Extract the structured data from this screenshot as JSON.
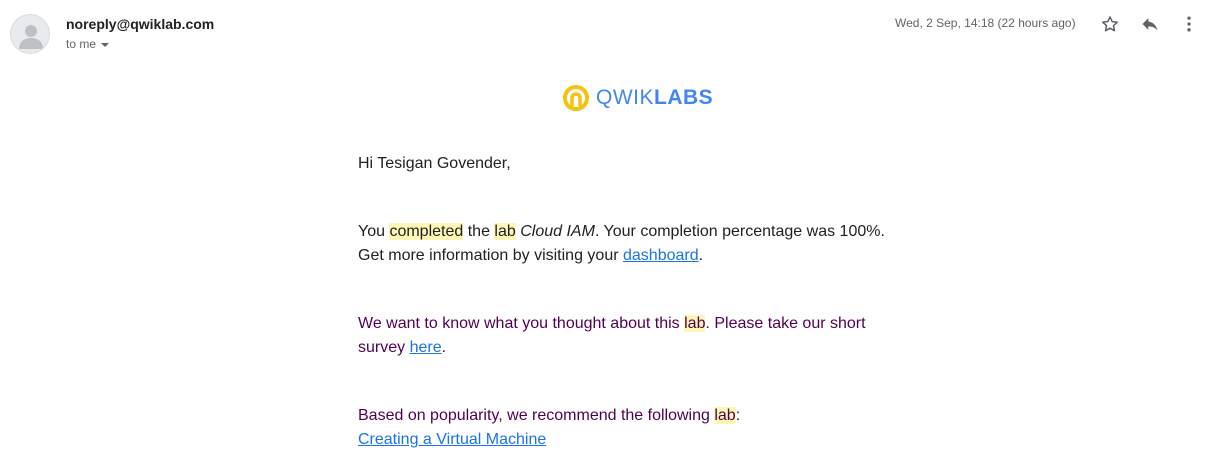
{
  "header": {
    "sender": "noreply@qwiklab.com",
    "recipient": "to me",
    "date": "Wed, 2 Sep, 14:18 (22 hours ago)"
  },
  "icons": [
    "avatar-person-icon",
    "star-icon",
    "reply-icon",
    "more-vert-icon",
    "qwiklabs-logo-icon"
  ],
  "logo": {
    "part1": "QWIK",
    "part2": "LABS"
  },
  "message": {
    "greeting": "Hi Tesigan Govender,",
    "p2": {
      "t1": "You ",
      "hl1": "completed",
      "t2": " the ",
      "hl2": "lab",
      "t3": " ",
      "lab_name": "Cloud IAM",
      "t4": ". Your completion percentage was 100%.",
      "t5": "Get more information by visiting your ",
      "link": "dashboard",
      "t6": "."
    },
    "p3": {
      "t1": "We want to know what you thought about this ",
      "hl": "lab",
      "t2": ". Please take our short",
      "t3": "survey ",
      "link": "here",
      "t4": "."
    },
    "p4": {
      "t1": "Based on popularity, we recommend the following ",
      "hl": "lab",
      "t2": ":",
      "link": "Creating a Virtual Machine"
    }
  },
  "colors": {
    "link": "#1a73e8",
    "purple_text": "#500050",
    "highlight": "#fff7b5",
    "logo_blue": "#4285f4",
    "logo_yellow": "#f4c20d"
  }
}
